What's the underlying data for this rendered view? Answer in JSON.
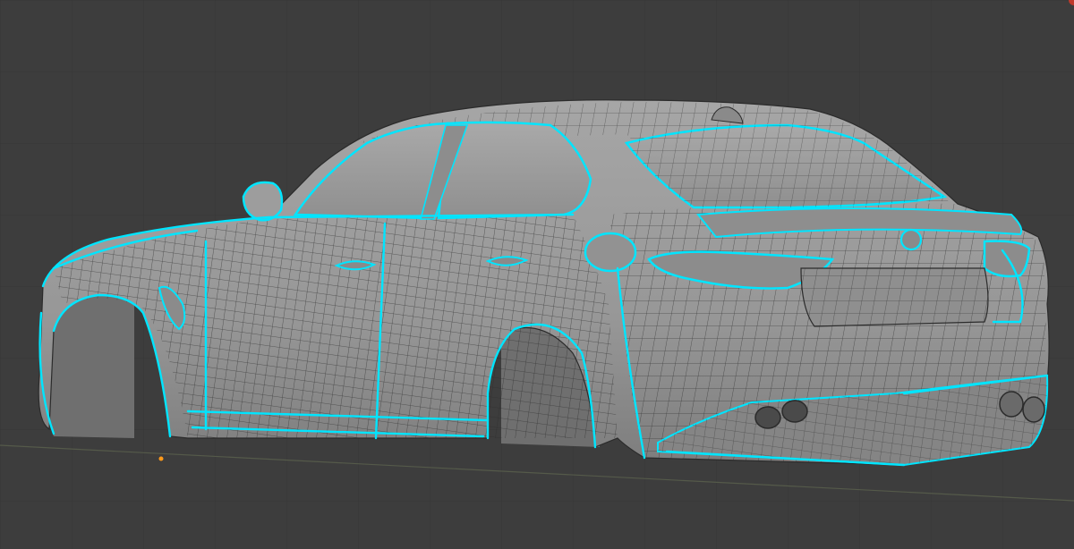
{
  "viewport": {
    "background": "#3d3d3d",
    "grid_color": "#363636",
    "floor_line_color": "#555a4a"
  },
  "model": {
    "body_color": "#9a9a9a",
    "body_shade_color": "#7e7e7e",
    "wire_color": "#2b2b2b",
    "selected_edge_color": "#00e5ff",
    "tire_color": "#6f6f6f",
    "exhaust_color": "#4a4a4a"
  },
  "origin_point": {
    "color": "#ff9a1a"
  },
  "corner_badge": {
    "color": "#c0392b"
  }
}
